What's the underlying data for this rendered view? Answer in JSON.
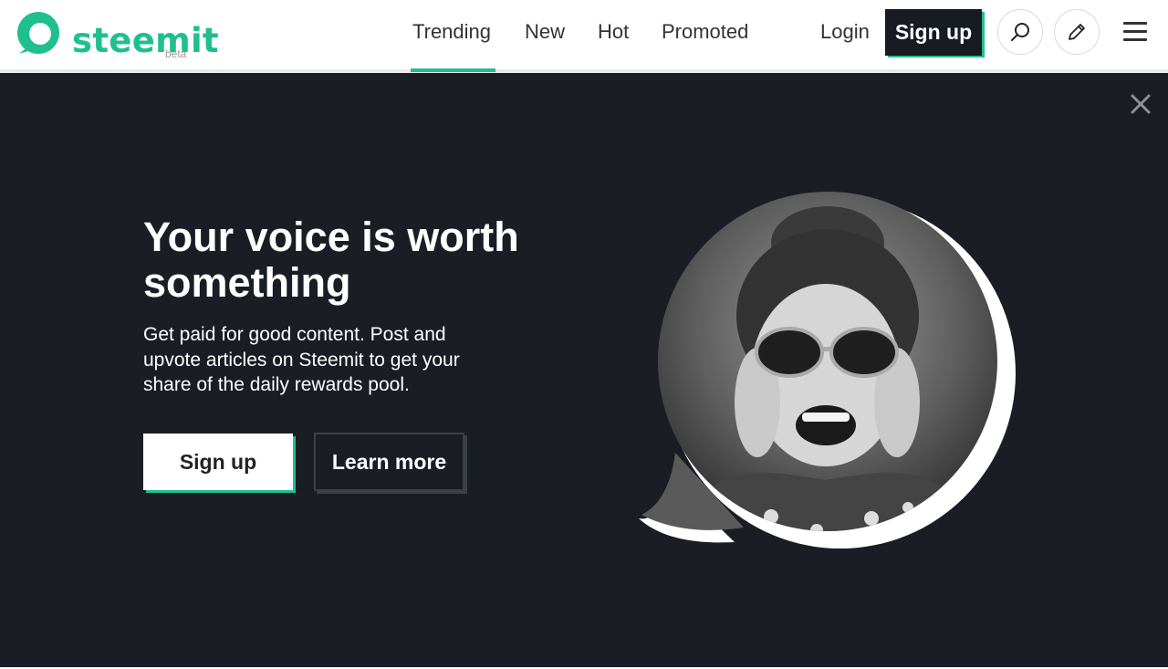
{
  "header": {
    "logo": {
      "wordmark": "steemit",
      "badge": "beta",
      "icon": "steemit-logo-icon"
    },
    "nav": [
      {
        "label": "Trending",
        "active": true
      },
      {
        "label": "New",
        "active": false
      },
      {
        "label": "Hot",
        "active": false
      },
      {
        "label": "Promoted",
        "active": false
      }
    ],
    "login_label": "Login",
    "signup_label": "Sign up",
    "search_icon": "search-icon",
    "submit_icon": "pencil-icon",
    "menu_icon": "hamburger-menu-icon"
  },
  "hero": {
    "headline": "Your voice is worth something",
    "description": "Get paid for good content. Post and upvote articles on Steemit to get your share of the daily rewards pool.",
    "primary_button": "Sign up",
    "secondary_button": "Learn more",
    "close_icon": "close-icon"
  },
  "colors": {
    "brand": "#1fbf8f",
    "hero_background": "#1a1d23",
    "button_dark": "#171b22"
  }
}
